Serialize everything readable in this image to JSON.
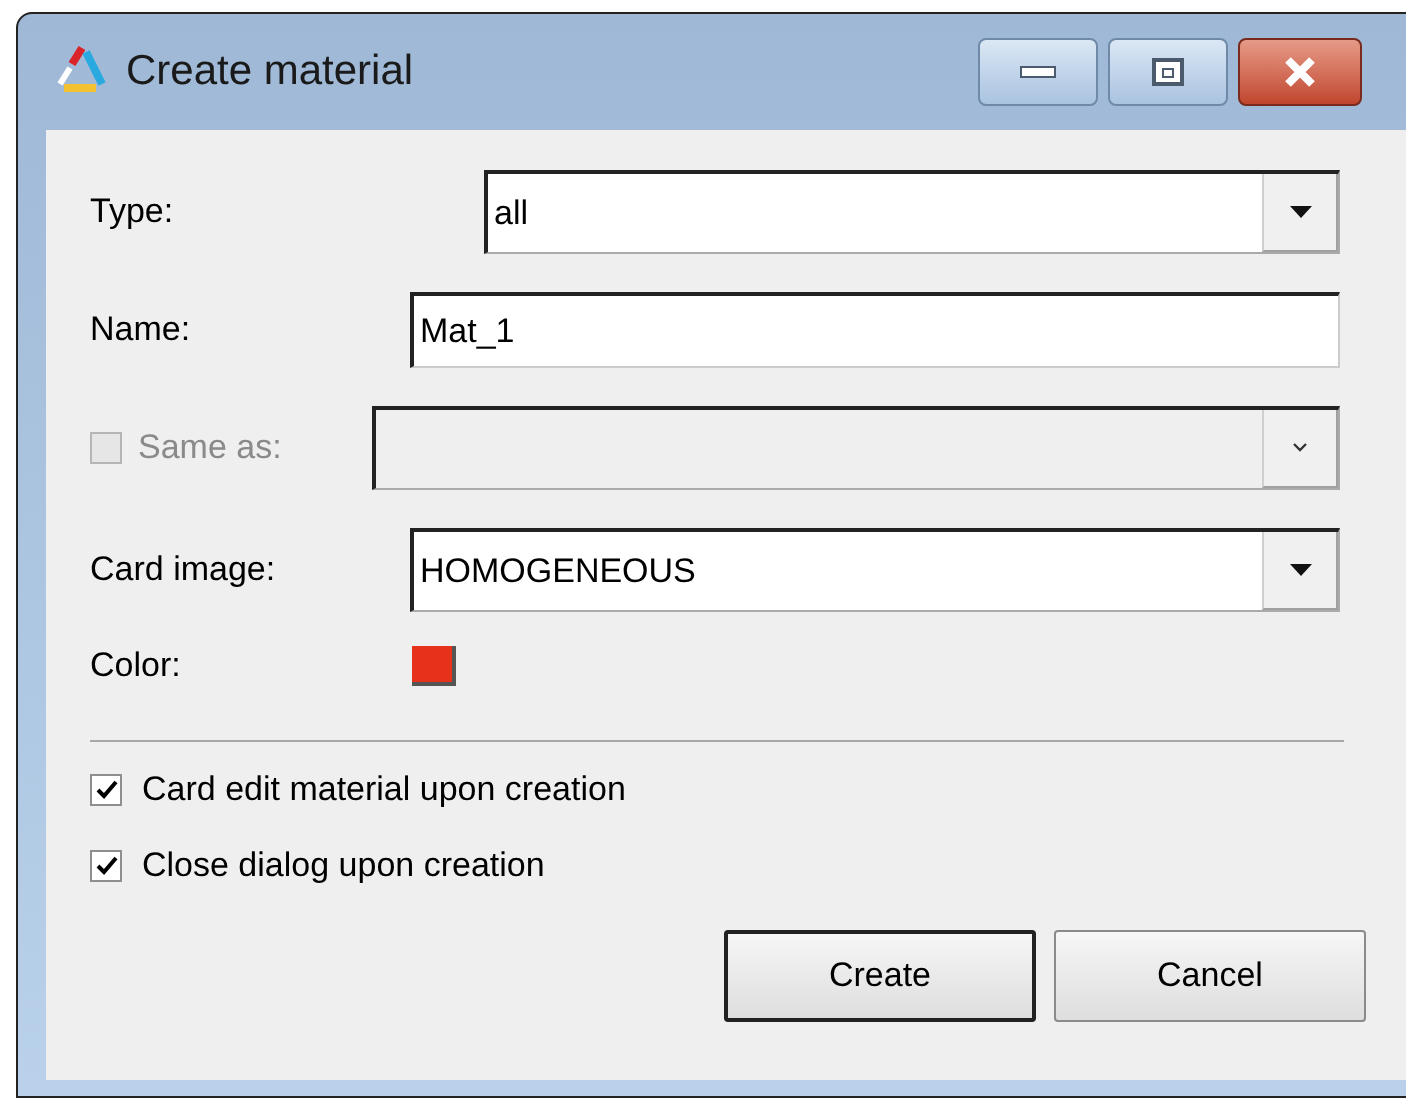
{
  "window": {
    "title": "Create material"
  },
  "title_buttons": [
    {
      "kind": "minimize"
    },
    {
      "kind": "maximize"
    },
    {
      "kind": "close"
    }
  ],
  "type": {
    "label": "Type:",
    "value": "all"
  },
  "name": {
    "label": "Name:",
    "value": "Mat_1"
  },
  "same_as": {
    "label": "Same as:",
    "checked": false,
    "disabled": true
  },
  "card_image": {
    "label": "Card image:",
    "value": "HOMOGENEOUS"
  },
  "color": {
    "label": "Color:",
    "color": "#e8311a"
  },
  "options": [
    {
      "label": "Card edit material upon creation",
      "checked": true
    },
    {
      "label": "Close dialog upon creation",
      "checked": true
    }
  ],
  "buttons": [
    {
      "label": "Create",
      "default": true
    },
    {
      "label": "Cancel",
      "default": false
    }
  ]
}
